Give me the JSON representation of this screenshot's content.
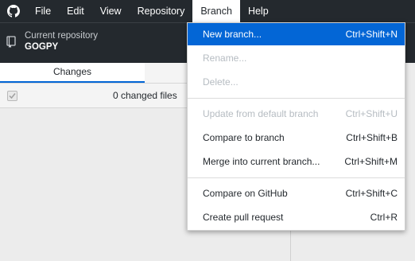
{
  "menubar": {
    "logo_icon": "github-octocat-icon",
    "items": [
      "File",
      "Edit",
      "View",
      "Repository",
      "Branch",
      "Help"
    ],
    "active_item": "Branch"
  },
  "toolbar": {
    "repo_caption": "Current repository",
    "repo_name": "GOGPY",
    "repo_icon": "repository-icon"
  },
  "left_pane": {
    "tabs": [
      "Changes"
    ],
    "changed_files": "0 changed files"
  },
  "branch_menu": {
    "items": [
      {
        "label": "New branch...",
        "shortcut": "Ctrl+Shift+N",
        "enabled": true,
        "highlighted": true
      },
      {
        "label": "Rename...",
        "shortcut": "",
        "enabled": false
      },
      {
        "label": "Delete...",
        "shortcut": "",
        "enabled": false
      },
      {
        "label": "Update from default branch",
        "shortcut": "Ctrl+Shift+U",
        "enabled": false
      },
      {
        "label": "Compare to branch",
        "shortcut": "Ctrl+Shift+B",
        "enabled": true
      },
      {
        "label": "Merge into current branch...",
        "shortcut": "Ctrl+Shift+M",
        "enabled": true
      },
      {
        "label": "Compare on GitHub",
        "shortcut": "Ctrl+Shift+C",
        "enabled": true
      },
      {
        "label": "Create pull request",
        "shortcut": "Ctrl+R",
        "enabled": true
      }
    ]
  },
  "colors": {
    "titlebar_bg": "#24292e",
    "highlight": "#0366d6",
    "disabled_text": "#b6bcc2"
  }
}
